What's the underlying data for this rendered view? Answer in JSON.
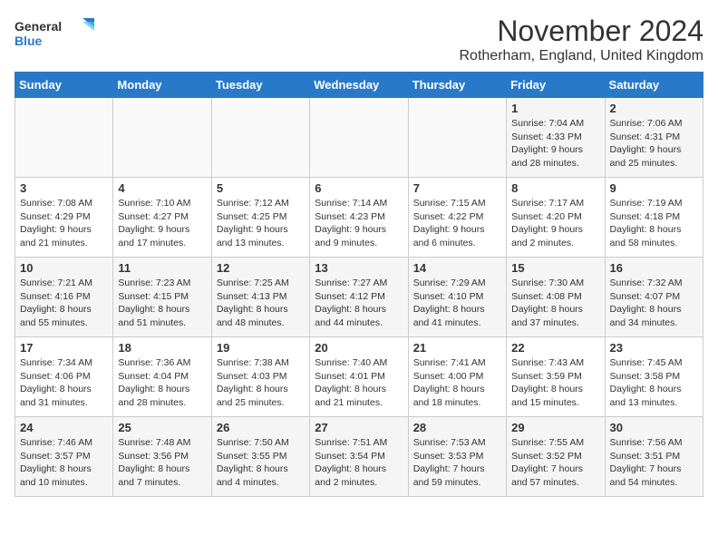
{
  "logo": {
    "line1": "General",
    "line2": "Blue"
  },
  "title": "November 2024",
  "location": "Rotherham, England, United Kingdom",
  "weekdays": [
    "Sunday",
    "Monday",
    "Tuesday",
    "Wednesday",
    "Thursday",
    "Friday",
    "Saturday"
  ],
  "weeks": [
    [
      {
        "day": "",
        "info": ""
      },
      {
        "day": "",
        "info": ""
      },
      {
        "day": "",
        "info": ""
      },
      {
        "day": "",
        "info": ""
      },
      {
        "day": "",
        "info": ""
      },
      {
        "day": "1",
        "info": "Sunrise: 7:04 AM\nSunset: 4:33 PM\nDaylight: 9 hours\nand 28 minutes."
      },
      {
        "day": "2",
        "info": "Sunrise: 7:06 AM\nSunset: 4:31 PM\nDaylight: 9 hours\nand 25 minutes."
      }
    ],
    [
      {
        "day": "3",
        "info": "Sunrise: 7:08 AM\nSunset: 4:29 PM\nDaylight: 9 hours\nand 21 minutes."
      },
      {
        "day": "4",
        "info": "Sunrise: 7:10 AM\nSunset: 4:27 PM\nDaylight: 9 hours\nand 17 minutes."
      },
      {
        "day": "5",
        "info": "Sunrise: 7:12 AM\nSunset: 4:25 PM\nDaylight: 9 hours\nand 13 minutes."
      },
      {
        "day": "6",
        "info": "Sunrise: 7:14 AM\nSunset: 4:23 PM\nDaylight: 9 hours\nand 9 minutes."
      },
      {
        "day": "7",
        "info": "Sunrise: 7:15 AM\nSunset: 4:22 PM\nDaylight: 9 hours\nand 6 minutes."
      },
      {
        "day": "8",
        "info": "Sunrise: 7:17 AM\nSunset: 4:20 PM\nDaylight: 9 hours\nand 2 minutes."
      },
      {
        "day": "9",
        "info": "Sunrise: 7:19 AM\nSunset: 4:18 PM\nDaylight: 8 hours\nand 58 minutes."
      }
    ],
    [
      {
        "day": "10",
        "info": "Sunrise: 7:21 AM\nSunset: 4:16 PM\nDaylight: 8 hours\nand 55 minutes."
      },
      {
        "day": "11",
        "info": "Sunrise: 7:23 AM\nSunset: 4:15 PM\nDaylight: 8 hours\nand 51 minutes."
      },
      {
        "day": "12",
        "info": "Sunrise: 7:25 AM\nSunset: 4:13 PM\nDaylight: 8 hours\nand 48 minutes."
      },
      {
        "day": "13",
        "info": "Sunrise: 7:27 AM\nSunset: 4:12 PM\nDaylight: 8 hours\nand 44 minutes."
      },
      {
        "day": "14",
        "info": "Sunrise: 7:29 AM\nSunset: 4:10 PM\nDaylight: 8 hours\nand 41 minutes."
      },
      {
        "day": "15",
        "info": "Sunrise: 7:30 AM\nSunset: 4:08 PM\nDaylight: 8 hours\nand 37 minutes."
      },
      {
        "day": "16",
        "info": "Sunrise: 7:32 AM\nSunset: 4:07 PM\nDaylight: 8 hours\nand 34 minutes."
      }
    ],
    [
      {
        "day": "17",
        "info": "Sunrise: 7:34 AM\nSunset: 4:06 PM\nDaylight: 8 hours\nand 31 minutes."
      },
      {
        "day": "18",
        "info": "Sunrise: 7:36 AM\nSunset: 4:04 PM\nDaylight: 8 hours\nand 28 minutes."
      },
      {
        "day": "19",
        "info": "Sunrise: 7:38 AM\nSunset: 4:03 PM\nDaylight: 8 hours\nand 25 minutes."
      },
      {
        "day": "20",
        "info": "Sunrise: 7:40 AM\nSunset: 4:01 PM\nDaylight: 8 hours\nand 21 minutes."
      },
      {
        "day": "21",
        "info": "Sunrise: 7:41 AM\nSunset: 4:00 PM\nDaylight: 8 hours\nand 18 minutes."
      },
      {
        "day": "22",
        "info": "Sunrise: 7:43 AM\nSunset: 3:59 PM\nDaylight: 8 hours\nand 15 minutes."
      },
      {
        "day": "23",
        "info": "Sunrise: 7:45 AM\nSunset: 3:58 PM\nDaylight: 8 hours\nand 13 minutes."
      }
    ],
    [
      {
        "day": "24",
        "info": "Sunrise: 7:46 AM\nSunset: 3:57 PM\nDaylight: 8 hours\nand 10 minutes."
      },
      {
        "day": "25",
        "info": "Sunrise: 7:48 AM\nSunset: 3:56 PM\nDaylight: 8 hours\nand 7 minutes."
      },
      {
        "day": "26",
        "info": "Sunrise: 7:50 AM\nSunset: 3:55 PM\nDaylight: 8 hours\nand 4 minutes."
      },
      {
        "day": "27",
        "info": "Sunrise: 7:51 AM\nSunset: 3:54 PM\nDaylight: 8 hours\nand 2 minutes."
      },
      {
        "day": "28",
        "info": "Sunrise: 7:53 AM\nSunset: 3:53 PM\nDaylight: 7 hours\nand 59 minutes."
      },
      {
        "day": "29",
        "info": "Sunrise: 7:55 AM\nSunset: 3:52 PM\nDaylight: 7 hours\nand 57 minutes."
      },
      {
        "day": "30",
        "info": "Sunrise: 7:56 AM\nSunset: 3:51 PM\nDaylight: 7 hours\nand 54 minutes."
      }
    ]
  ]
}
